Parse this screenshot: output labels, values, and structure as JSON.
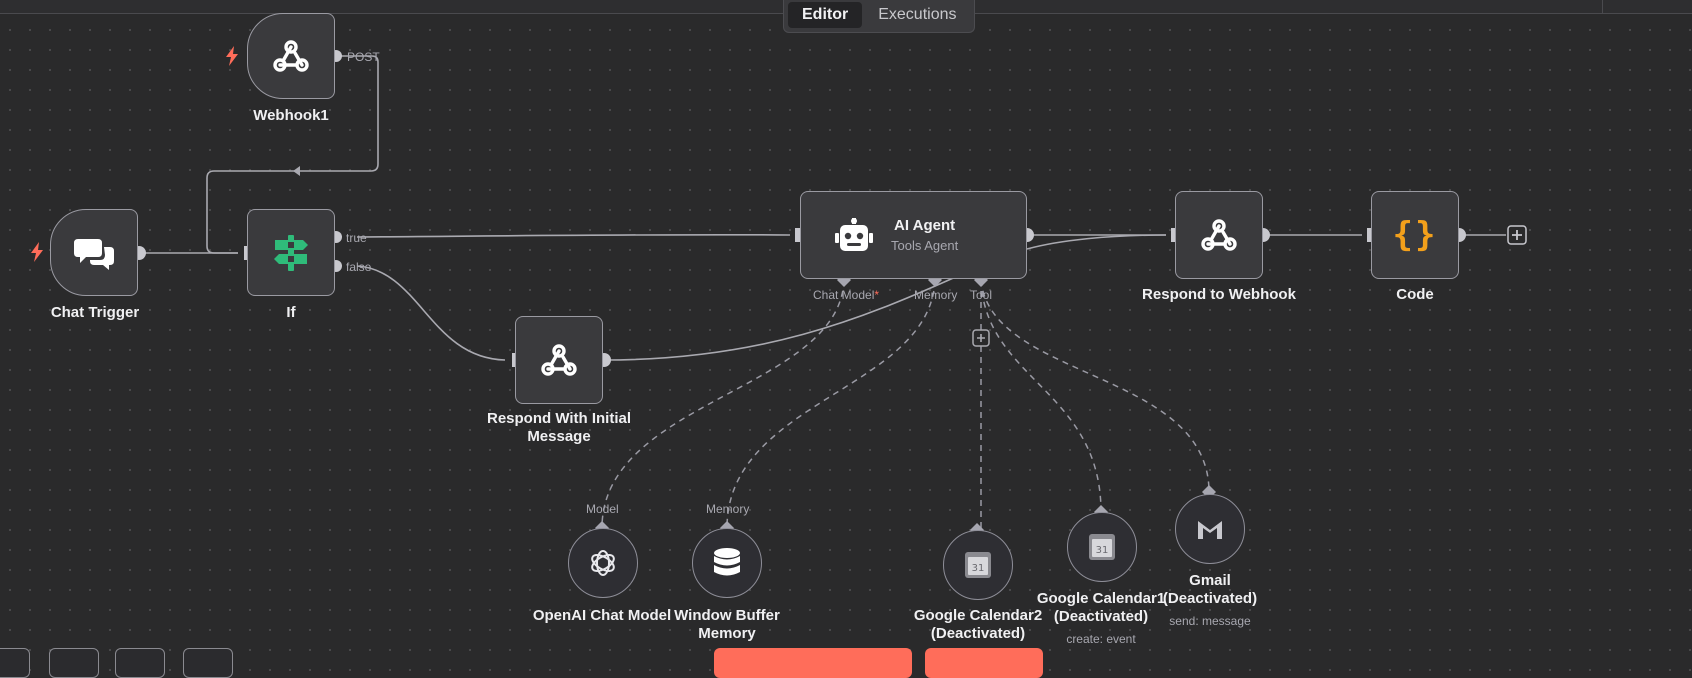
{
  "tabs": [
    {
      "label": "Editor",
      "active": true
    },
    {
      "label": "Executions",
      "active": false
    }
  ],
  "colors": {
    "accent": "#ff6d5a",
    "if_icon": "#2fbb7a",
    "code_icon": "#f3a01b"
  },
  "nodes": {
    "webhook1": {
      "label": "Webhook1",
      "output": "POST",
      "icon": "webhook-icon"
    },
    "chat_trigger": {
      "label": "Chat Trigger",
      "icon": "chat-bubbles-icon"
    },
    "if_node": {
      "label": "If",
      "outputs": {
        "true": "true",
        "false": "false"
      },
      "icon": "signpost-icon"
    },
    "ai_agent": {
      "title": "AI Agent",
      "subtitle": "Tools Agent",
      "icon": "robot-icon",
      "ports": {
        "chat_model": "Chat Model",
        "chat_model_required": "*",
        "memory": "Memory",
        "tool": "Tool"
      }
    },
    "respond_initial": {
      "label": "Respond With Initial Message",
      "label_line1": "Respond With Initial",
      "label_line2": "Message",
      "icon": "webhook-icon"
    },
    "respond_webhook": {
      "label": "Respond to Webhook",
      "icon": "webhook-icon"
    },
    "code": {
      "label": "Code",
      "icon": "code-braces-icon",
      "glyph": "{}"
    },
    "openai": {
      "label": "OpenAI Chat Model",
      "port": "Model",
      "icon": "openai-icon"
    },
    "memory": {
      "label_line1": "Window Buffer",
      "label_line2": "Memory",
      "port": "Memory",
      "icon": "database-icon"
    },
    "gcal2": {
      "label_line1": "Google Calendar2",
      "label_line2": "(Deactivated)",
      "icon": "google-calendar-icon"
    },
    "gcal1": {
      "label_line1": "Google Calendar1",
      "label_line2": "(Deactivated)",
      "subtitle": "create: event",
      "icon": "google-calendar-icon"
    },
    "gmail": {
      "label_line1": "Gmail",
      "label_line2": "(Deactivated)",
      "subtitle": "send: message",
      "icon": "gmail-icon"
    }
  }
}
